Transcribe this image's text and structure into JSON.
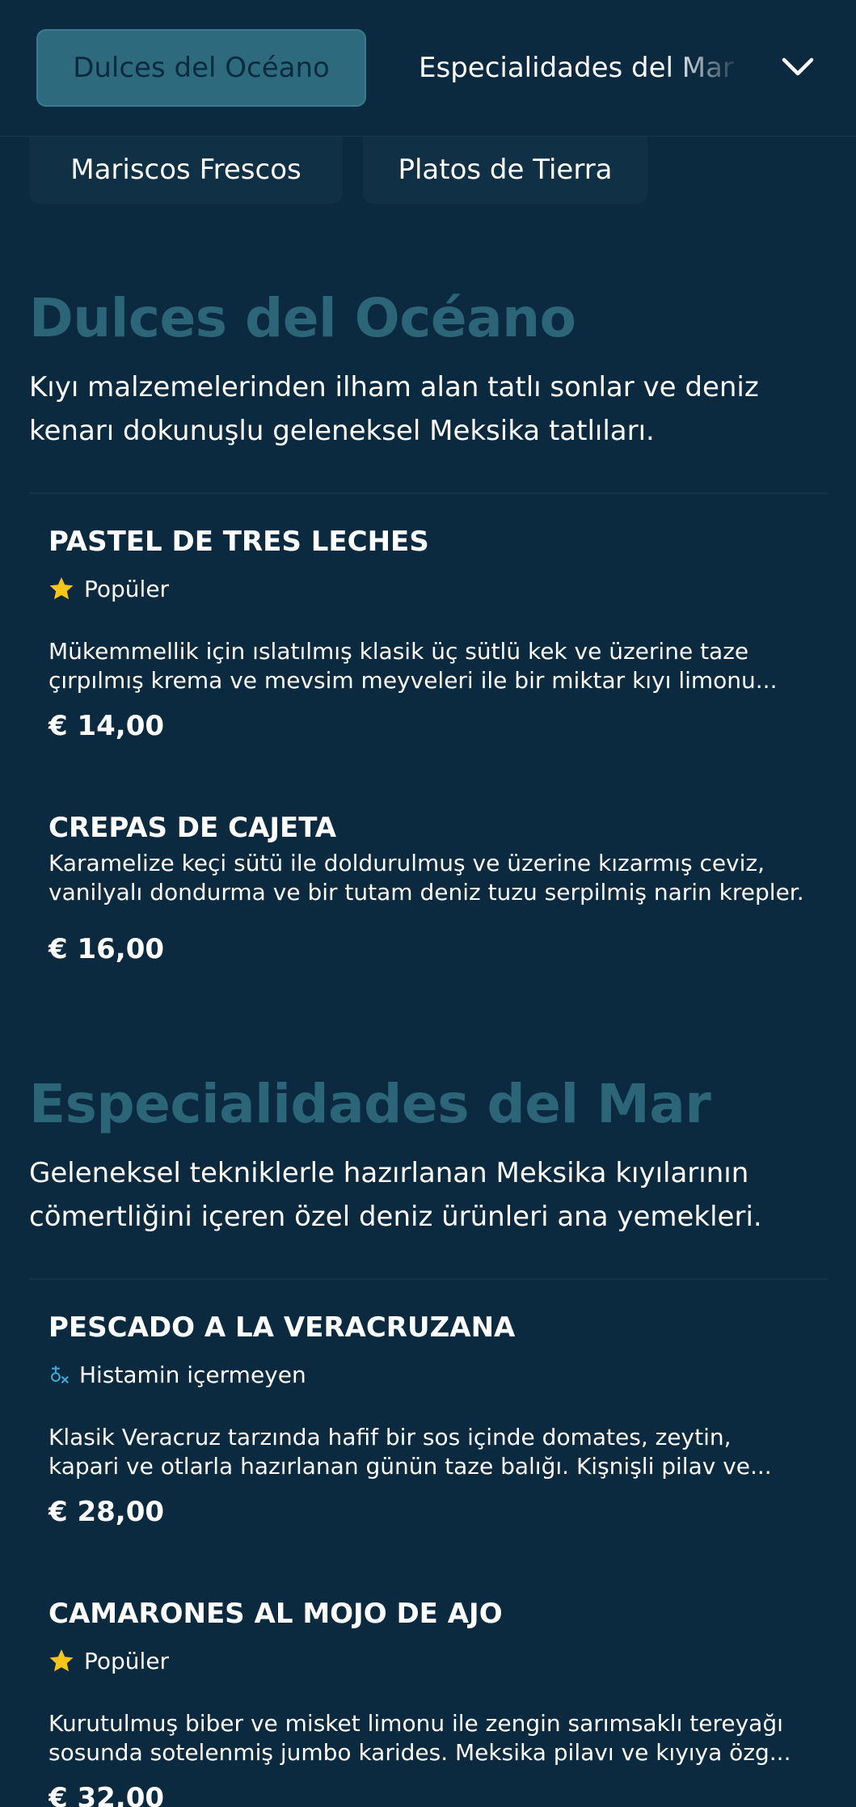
{
  "nav": {
    "active_tab": "Dulces del Océano",
    "next_tab": "Especialidades del Mar",
    "row2_tabs": [
      "Mariscos Frescos",
      "Platos de Tierra"
    ]
  },
  "sections": [
    {
      "title": "Dulces del Océano",
      "description": "Kıyı malzemelerinden ilham alan tatlı sonlar ve deniz kenarı dokunuşlu geleneksel Meksika tatlıları.",
      "items": [
        {
          "name": "PASTEL DE TRES LECHES",
          "badge": "Popüler",
          "description": "Mükemmellik için ıslatılmış klasik üç sütlü kek ve üzerine taze çırpılmış krema ve mevsim meyveleri ile bir miktar kıyı limonu...",
          "price": "€ 14,00"
        },
        {
          "name": "CREPAS DE CAJETA",
          "description": "Karamelize keçi sütü ile doldurulmuş ve üzerine kızarmış ceviz, vanilyalı dondurma ve bir tutam deniz tuzu serpilmiş narin krepler.",
          "price": "€ 16,00"
        }
      ]
    },
    {
      "title": "Especialidades del Mar",
      "description": "Geleneksel tekniklerle hazırlanan Meksika kıyılarının cömertliğini içeren özel deniz ürünleri ana yemekleri.",
      "items": [
        {
          "name": "PESCADO A LA VERACRUZANA",
          "badge": "Histamin içermeyen",
          "description": "Klasik Veracruz tarzında hafif bir sos içinde domates, zeytin, kapari ve otlarla hazırlanan günün taze balığı. Kişnişli pilav ve...",
          "price": "€ 28,00"
        },
        {
          "name": "CAMARONES AL MOJO DE AJO",
          "badge": "Popüler",
          "description": "Kurutulmuş biber ve misket limonu ile zengin sarımsaklı tereyağı sosunda sotelenmiş jumbo karides. Meksika pilavı ve kıyıya özg...",
          "price": "€ 32,00"
        }
      ]
    }
  ],
  "colors": {
    "background": "#0c2a3f",
    "accent": "#2d6a7d",
    "star": "#f5c518",
    "histamine": "#3fa9d6"
  },
  "icons": {
    "chevron": "chevron-down-icon",
    "popular": "star-icon",
    "histamine_free": "no-histamine-icon"
  }
}
